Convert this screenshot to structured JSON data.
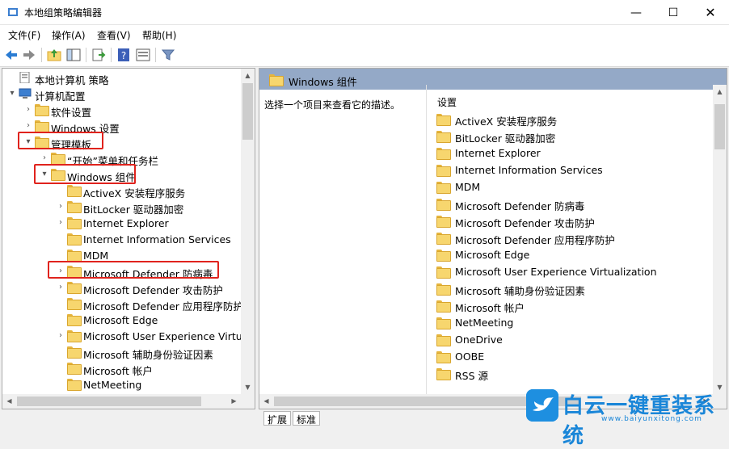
{
  "window": {
    "title": "本地组策略编辑器",
    "minimize": "—",
    "maximize": "☐",
    "close": "✕"
  },
  "menu": {
    "items": [
      "文件(F)",
      "操作(A)",
      "查看(V)",
      "帮助(H)"
    ]
  },
  "toolbar": {
    "icons": [
      "back-arrow-icon",
      "forward-arrow-icon",
      "up-folder-icon",
      "show-hide-tree-icon",
      "export-list-icon",
      "help-icon",
      "properties-icon",
      "filter-icon"
    ]
  },
  "tree": {
    "items": [
      {
        "label": "本地计算机 策略",
        "icon": "policy-doc-icon",
        "arrow": ""
      },
      {
        "label": "计算机配置",
        "icon": "computer-icon",
        "arrow": "▾"
      },
      {
        "label": "软件设置",
        "icon": "folder-icon",
        "arrow": "›"
      },
      {
        "label": "Windows 设置",
        "icon": "folder-icon",
        "arrow": "›"
      },
      {
        "label": "管理模板",
        "icon": "folder-icon",
        "arrow": "▾"
      },
      {
        "label": "“开始”菜单和任务栏",
        "icon": "folder-icon",
        "arrow": "›"
      },
      {
        "label": "Windows 组件",
        "icon": "folder-icon",
        "arrow": "▾"
      },
      {
        "label": "ActiveX 安装程序服务",
        "icon": "folder-icon",
        "arrow": ""
      },
      {
        "label": "BitLocker 驱动器加密",
        "icon": "folder-icon",
        "arrow": "›"
      },
      {
        "label": "Internet Explorer",
        "icon": "folder-icon",
        "arrow": "›"
      },
      {
        "label": "Internet Information Services",
        "icon": "folder-icon",
        "arrow": ""
      },
      {
        "label": "MDM",
        "icon": "folder-icon",
        "arrow": ""
      },
      {
        "label": "Microsoft Defender 防病毒",
        "icon": "folder-icon",
        "arrow": "›"
      },
      {
        "label": "Microsoft Defender 攻击防护",
        "icon": "folder-icon",
        "arrow": "›"
      },
      {
        "label": "Microsoft Defender 应用程序防护",
        "icon": "folder-icon",
        "arrow": ""
      },
      {
        "label": "Microsoft Edge",
        "icon": "folder-icon",
        "arrow": ""
      },
      {
        "label": "Microsoft User Experience Virtual",
        "icon": "folder-icon",
        "arrow": "›"
      },
      {
        "label": "Microsoft 辅助身份验证因素",
        "icon": "folder-icon",
        "arrow": ""
      },
      {
        "label": "Microsoft 帐户",
        "icon": "folder-icon",
        "arrow": ""
      },
      {
        "label": "NetMeeting",
        "icon": "folder-icon",
        "arrow": ""
      }
    ]
  },
  "right_pane": {
    "header": "Windows 组件",
    "description": "选择一个项目来查看它的描述。",
    "column_header": "设置",
    "items": [
      "ActiveX 安装程序服务",
      "BitLocker 驱动器加密",
      "Internet Explorer",
      "Internet Information Services",
      "MDM",
      "Microsoft Defender 防病毒",
      "Microsoft Defender 攻击防护",
      "Microsoft Defender 应用程序防护",
      "Microsoft Edge",
      "Microsoft User Experience Virtualization",
      "Microsoft 辅助身份验证因素",
      "Microsoft 帐户",
      "NetMeeting",
      "OneDrive",
      "OOBE",
      "RSS 源"
    ]
  },
  "tabs": [
    "扩展",
    "标准"
  ],
  "watermark": {
    "main": "白云一键重装系统",
    "sub": "www.baiyunxitong.com"
  },
  "colors": {
    "highlight_box": "#e0231d",
    "header_bg": "#94a9c7",
    "brand": "#1a86d8"
  }
}
